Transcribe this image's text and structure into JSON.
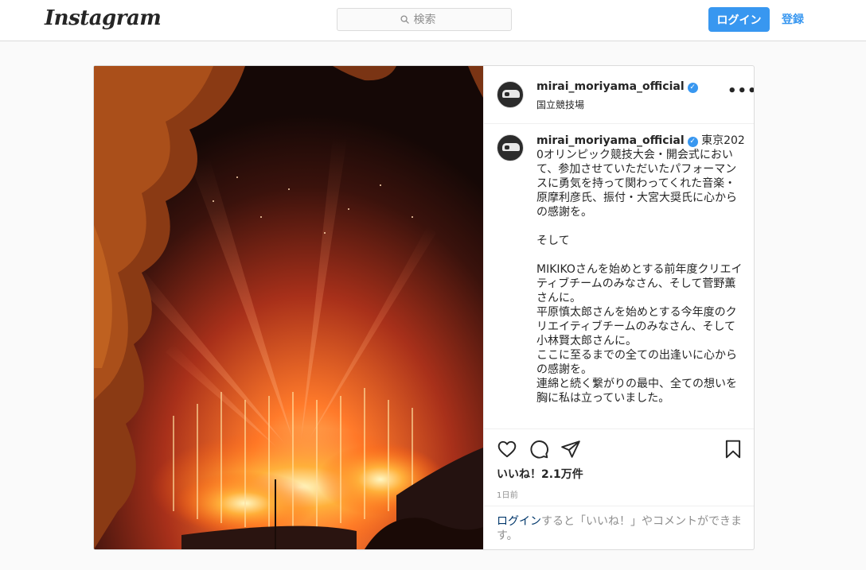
{
  "header": {
    "logo": "Instagram",
    "search_placeholder": "検索",
    "login_label": "ログイン",
    "signup_label": "登録"
  },
  "post": {
    "username": "mirai_moriyama_official",
    "location": "国立競技場",
    "more_label": "•••",
    "caption": "東京2020オリンピック競技大会・開会式において、参加させていただいたパフォーマンスに勇気を持って関わってくれた音楽・原摩利彦氏、振付・大宮大奨氏に心からの感謝を。\n\nそして\n\nMIKIKOさんを始めとする前年度クリエイティブチームのみなさん、そして菅野薫さんに。\n平原慎太郎さんを始めとする今年度のクリエイティブチームのみなさん、そして小林賢太郎さんに。\nここに至るまでの全ての出逢いに心からの感謝を。\n連綿と続く繋がりの最中、全ての想いを胸に私は立っていました。",
    "likes": "いいね！2.1万件",
    "time": "1日前",
    "login_prompt_link": "ログイン",
    "login_prompt_rest": "すると「いいね！」やコメントができます。"
  },
  "colors": {
    "accent": "#3897f0",
    "border": "#dbdbdb",
    "muted": "#8e8e8e"
  },
  "icons": [
    "search-icon",
    "verified-icon",
    "heart-icon",
    "comment-icon",
    "share-icon",
    "bookmark-icon"
  ]
}
